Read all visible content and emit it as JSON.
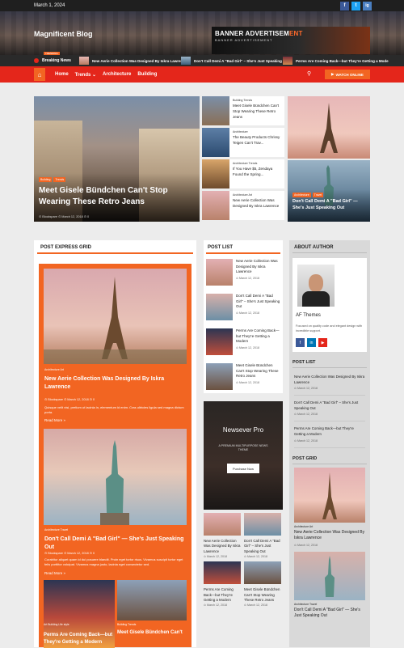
{
  "topbar": {
    "date": "March 1, 2024",
    "social": [
      "f",
      "t",
      "ig"
    ]
  },
  "site": {
    "title": "Magnificent Blog"
  },
  "banner": {
    "line1a": "BANNER ADVERTISEM",
    "line1b": "ENT",
    "line2": "BANNER ADVERTISEMENT"
  },
  "ticker": {
    "label": "Breaking News",
    "trending": "TRENDING",
    "items": [
      "New Aerie Collection Was Designed By Iskra Lawrence",
      "Don't Call Demi A \"Bad Girl\" – She's Just Speaking Out",
      "Perms Are Coming Back—but They're Getting a Mode"
    ]
  },
  "nav": {
    "items": [
      "Home",
      "Trends ⌄",
      "Architecture",
      "Building"
    ],
    "watch": "WATCH ONLINE"
  },
  "featured": {
    "tags": [
      "Building",
      "Trends"
    ],
    "title": "Meet Gisele Bündchen Can't Stop Wearing These Retro Jeans",
    "meta": "⊙ Blockspare   ⊙ March 12, 2018   ⊙ 0"
  },
  "mid_items": [
    {
      "cat": "Building   Trends",
      "title": "Meet Gisele Bündchen Can't Stop Wearing These Retro Jeans"
    },
    {
      "cat": "Architecture",
      "title": "The Beauty Products Chrissy Teigen Can't Trav..."
    },
    {
      "cat": "Architecture   Trends",
      "title": "If You Have $5, Zendaya Found the Spring..."
    },
    {
      "cat": "Architecture   Art",
      "title": "New Aerie Collection Was Designed By Iskra Lawrence"
    }
  ],
  "right_feature": {
    "tags": [
      "Architecture",
      "Travel"
    ],
    "title": "Don't Call Demi A \"Bad Girl\" — She's Just Speaking Out"
  },
  "express": {
    "heading": "POST EXPRESS GRID",
    "posts": [
      {
        "cat": "Architecture   Art",
        "title": "New Aerie Collection Was Designed By Iskra Lawrence",
        "meta": "⊙ Blockspare   ⊙ March 12, 2018   ⊙ 0",
        "excerpt": "Quisque velit nisi, pretium ut lacinia in, elementum id enim. Cras ultricies ligula sed magna dictum porta.",
        "more": "Read More »"
      },
      {
        "cat": "Architecture   Travel",
        "title": "Don't Call Demi A \"Bad Girl\" — She's Just Speaking Out",
        "meta": "⊙ Blockspare   ⊙ March 12, 2018   ⊙ 0",
        "excerpt": "Curabitur aliquet quam id dui posuere blandit. Proin eget tortor risus. Vivamus suscipit tortor eget felis porttitor volutpat. Vivamus magna justo, lacinia eget consectetur sed.",
        "more": "Read More »"
      }
    ],
    "bottom": [
      {
        "cat": "Art   Building   Life style",
        "title": "Perms Are Coming Back—but They're Getting a Modern"
      },
      {
        "cat": "Building   Trends",
        "title": "Meet Gisele Bündchen Can't"
      }
    ]
  },
  "postlist": {
    "heading": "POST LIST",
    "items": [
      {
        "title": "New Aerie Collection Was Designed By Iskra Lawrence",
        "date": "⊙ March 12, 2018"
      },
      {
        "title": "Don't Call Demi A \"Bad Girl\" – She's Just Speaking Out",
        "date": "⊙ March 12, 2018"
      },
      {
        "title": "Perms Are Coming Back—but They're Getting a Modern",
        "date": "⊙ March 12, 2018"
      },
      {
        "title": "Meet Gisele Bündchen Can't Stop Wearing These Retro Jeans",
        "date": "⊙ March 12, 2018"
      }
    ],
    "promo": {
      "title": "Newsever Pro",
      "subtitle": "A PREMIUM MULTIPURPOSE NEWS THEME",
      "button": "Purchase Now"
    },
    "grid": [
      {
        "title": "New Aerie Collection Was Designed By Iskra Lawrence",
        "date": "⊙ March 12, 2018"
      },
      {
        "title": "Don't Call Demi A \"Bad Girl\" – She's Just Speaking Out",
        "date": "⊙ March 12, 2018"
      },
      {
        "title": "Perms Are Coming Back—but They're Getting a Modern",
        "date": "⊙ March 12, 2018"
      },
      {
        "title": "Meet Gisele Bündchen Can't Stop Wearing These Retro Jeans",
        "date": "⊙ March 12, 2018"
      }
    ]
  },
  "about": {
    "heading": "ABOUT AUTHOR",
    "name": "AF Themes",
    "bio": "Focused on quality code and elegant design with incredible support.",
    "social": [
      "f",
      "in",
      "▶"
    ]
  },
  "side_postlist": {
    "heading": "POST LIST",
    "items": [
      {
        "title": "New Aerie Collection Was Designed By Iskra Lawrence",
        "date": "⊙ March 12, 2018"
      },
      {
        "title": "Don't Call Demi A \"Bad Girl\" – She's Just Speaking Out",
        "date": "⊙ March 12, 2018"
      },
      {
        "title": "Perms Are Coming Back—but They're Getting a Modern",
        "date": "⊙ March 12, 2018"
      }
    ]
  },
  "side_grid": {
    "heading": "POST GRID",
    "items": [
      {
        "cat": "Architecture   Art",
        "title": "New Aerie Collection Was Designed By Iskra Lawrence",
        "date": "⊙ March 12, 2018"
      },
      {
        "cat": "Architecture   Travel",
        "title": "Don't Call Demi A \"Bad Girl\" — She's Just Speaking Out",
        "date": ""
      }
    ]
  },
  "colors": {
    "accent": "#f26522",
    "nav": "#e4261b",
    "dark": "#1f1f1f",
    "facebook": "#3b5998",
    "twitter": "#1da1f2",
    "linkedin": "#0077b5",
    "youtube": "#e4261b",
    "instagram": "#4a7fc1"
  }
}
